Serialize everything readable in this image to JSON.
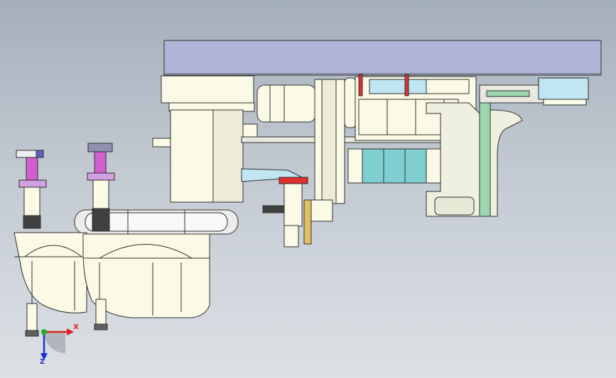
{
  "viewport": {
    "background_top": "#a4afbb",
    "background_bottom": "#dde1e6"
  },
  "triad": {
    "x_label": "X",
    "z_label": "Z",
    "x_color": "#e02020",
    "z_color": "#2030d0",
    "origin_color": "#20b020"
  },
  "model": {
    "body_color": "#fafae6",
    "edge_color": "#303030",
    "plate_color": "#aeb4d6",
    "accent_pink": "#d060d0",
    "accent_red": "#e03030",
    "accent_green": "#9ed6b0",
    "accent_teal": "#7fcfd0"
  }
}
